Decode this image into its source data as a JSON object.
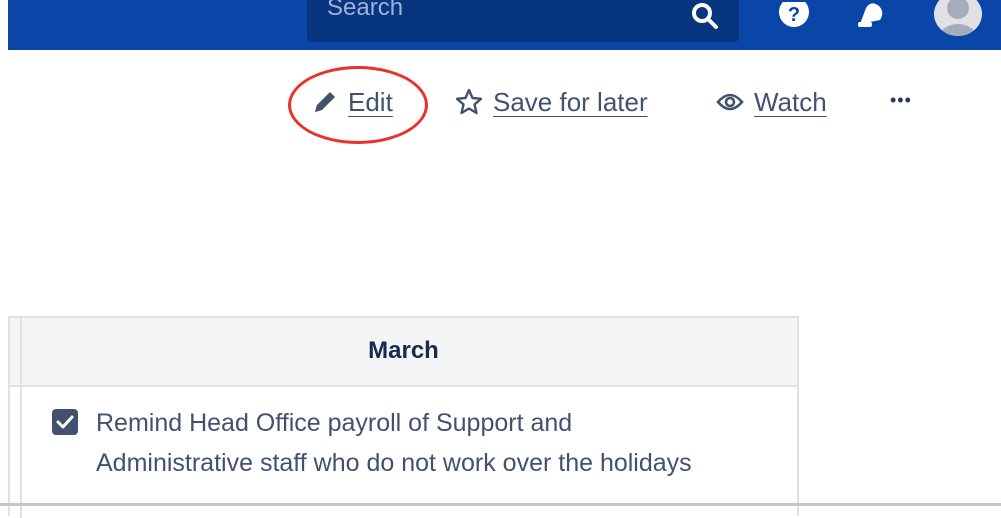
{
  "topbar": {
    "search_placeholder": "Search",
    "search_icon": "search-icon",
    "help_icon": "help-icon",
    "notifications_icon": "bell-icon",
    "avatar_icon": "user-avatar-icon",
    "background_color": "#0a45a8"
  },
  "actions": {
    "edit_label": "Edit",
    "save_label": "Save for later",
    "watch_label": "Watch",
    "more_label": "•••",
    "edit_icon": "pencil-icon",
    "save_icon": "star-icon",
    "watch_icon": "eye-icon",
    "highlight_color": "#e8322a"
  },
  "table": {
    "header": "March",
    "tasks": [
      {
        "checked": true,
        "text": "Remind Head Office payroll of Support and Administrative staff who do not work over the holidays"
      }
    ]
  }
}
